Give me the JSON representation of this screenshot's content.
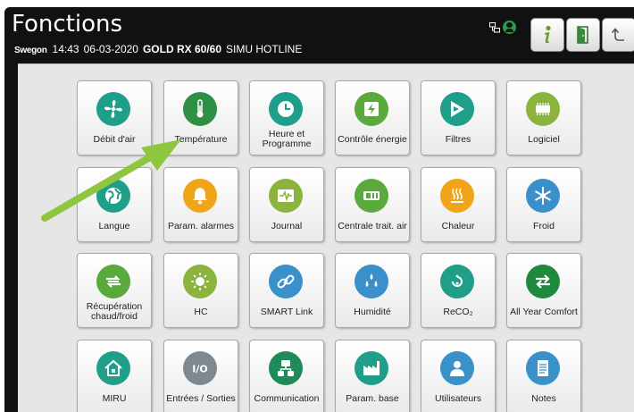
{
  "header": {
    "title": "Fonctions",
    "brand": "Swegon",
    "time": "14:43",
    "date": "06-03-2020",
    "model": "GOLD RX 60/60",
    "unit_name": "SIMU HOTLINE"
  },
  "toolbar": {
    "icons": [
      "network-icon",
      "user-icon",
      "info-icon",
      "exit-door-icon",
      "back-icon"
    ]
  },
  "tiles": [
    {
      "label": "Débit d'air",
      "icon": "fan-icon",
      "color": "#1f9e8a"
    },
    {
      "label": "Température",
      "icon": "thermometer-icon",
      "color": "#2e8f45"
    },
    {
      "label": "Heure et Programme",
      "icon": "clock-icon",
      "color": "#1f9e8a"
    },
    {
      "label": "Contrôle énergie",
      "icon": "energy-icon",
      "color": "#5aa93c"
    },
    {
      "label": "Filtres",
      "icon": "filter-icon",
      "color": "#1f9e8a"
    },
    {
      "label": "Logiciel",
      "icon": "chip-icon",
      "color": "#8ab43e"
    },
    {
      "label": "Langue",
      "icon": "globe-icon",
      "color": "#1f9e8a"
    },
    {
      "label": "Param. alarmes",
      "icon": "bell-icon",
      "color": "#f0a418"
    },
    {
      "label": "Journal",
      "icon": "log-icon",
      "color": "#8ab43e"
    },
    {
      "label": "Centrale trait. air",
      "icon": "ahu-icon",
      "color": "#5aa93c"
    },
    {
      "label": "Chaleur",
      "icon": "heat-icon",
      "color": "#f0a418"
    },
    {
      "label": "Froid",
      "icon": "snowflake-icon",
      "color": "#3a90c8"
    },
    {
      "label": "Récupération chaud/froid",
      "icon": "recovery-icon",
      "color": "#5aa93c"
    },
    {
      "label": "HC",
      "icon": "hc-icon",
      "color": "#8ab43e"
    },
    {
      "label": "SMART Link",
      "icon": "link-icon",
      "color": "#3a90c8"
    },
    {
      "label": "Humidité",
      "icon": "drops-icon",
      "color": "#3a90c8"
    },
    {
      "label": "ReCO₂",
      "icon": "reco2-icon",
      "color": "#1f9e8a"
    },
    {
      "label": "All Year Comfort",
      "icon": "arrows-icon",
      "color": "#1f8a3e"
    },
    {
      "label": "MIRU",
      "icon": "house-icon",
      "color": "#1f9e8a"
    },
    {
      "label": "Entrées / Sorties",
      "icon": "io-icon",
      "color": "#7d8890"
    },
    {
      "label": "Communication",
      "icon": "network-tree-icon",
      "color": "#1f8a5a"
    },
    {
      "label": "Param. base",
      "icon": "factory-icon",
      "color": "#1f9e8a"
    },
    {
      "label": "Utilisateurs",
      "icon": "person-icon",
      "color": "#3a90c8"
    },
    {
      "label": "Notes",
      "icon": "notes-icon",
      "color": "#3a90c8"
    }
  ],
  "colors": {
    "header_bg": "#111111",
    "content_bg": "#e6e6e6",
    "highlight_arrow": "#8ec63f"
  }
}
